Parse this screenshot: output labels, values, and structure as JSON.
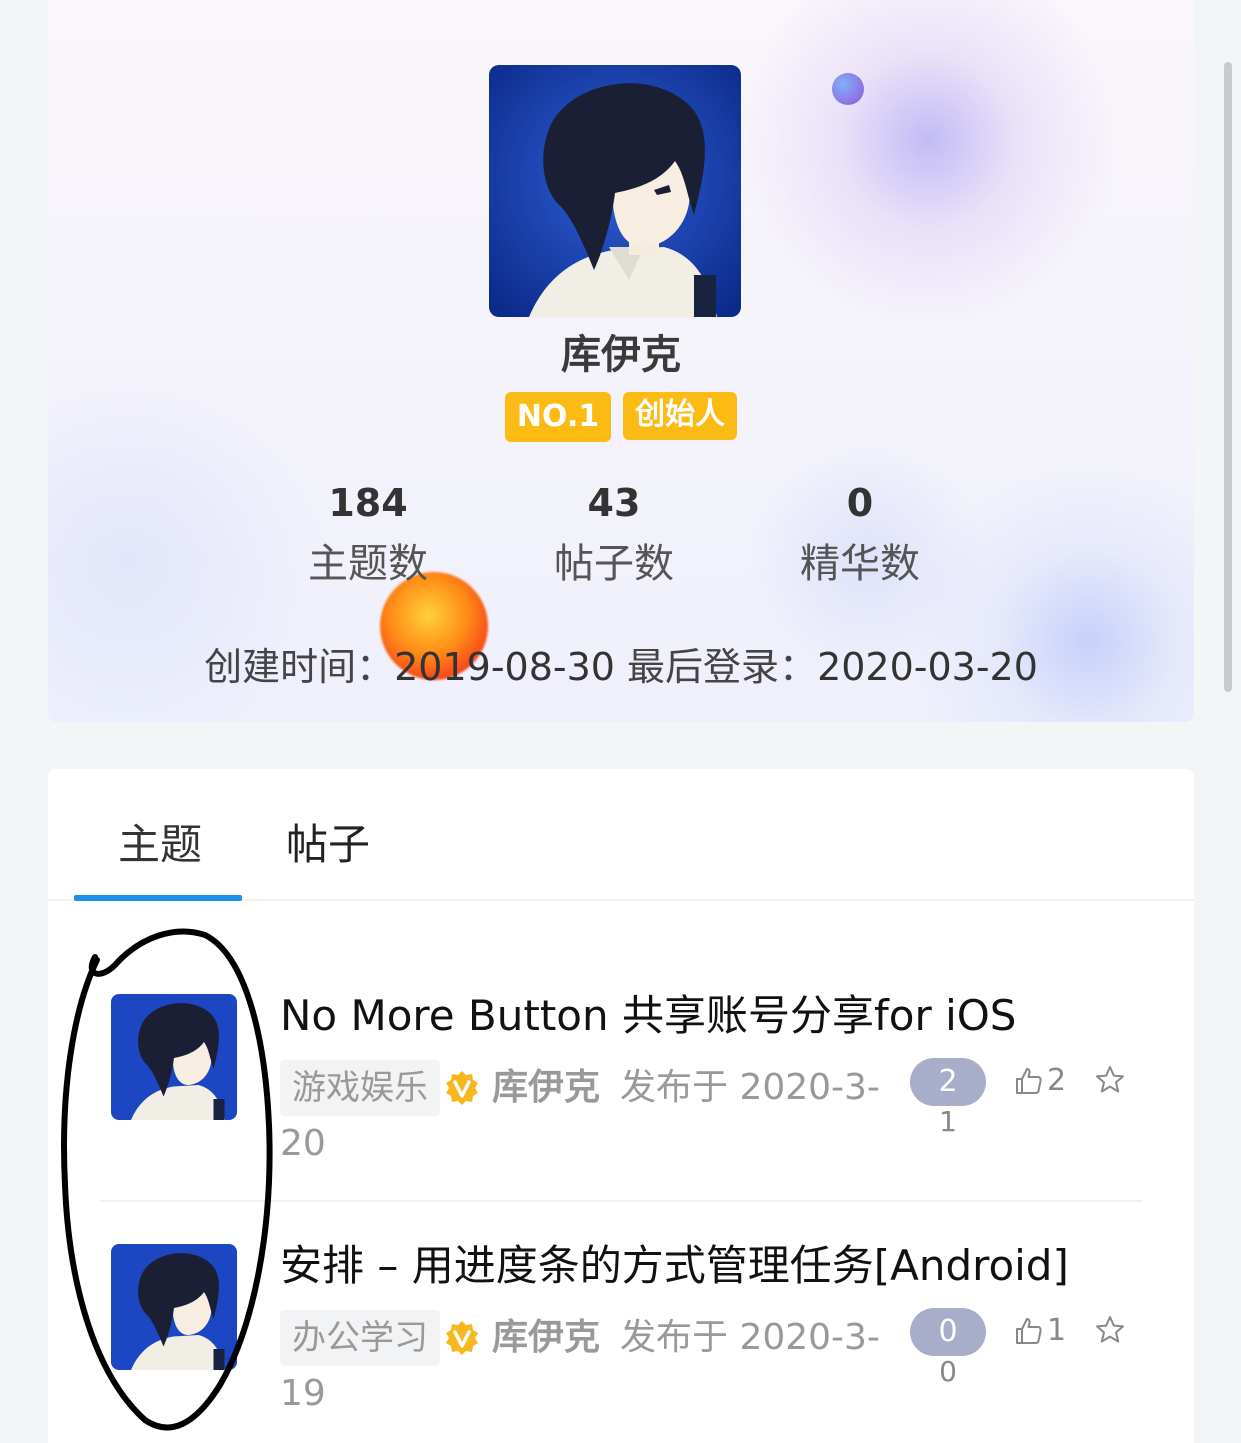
{
  "profile": {
    "name": "库伊克",
    "badges": [
      "NO.1",
      "创始人"
    ],
    "stats": [
      {
        "value": "184",
        "label": "主题数"
      },
      {
        "value": "43",
        "label": "帖子数"
      },
      {
        "value": "0",
        "label": "精华数"
      }
    ],
    "created_label": "创建时间：",
    "created_value": "2019-08-30",
    "last_login_label": "最后登录：",
    "last_login_value": "2020-03-20"
  },
  "tabs": [
    {
      "label": "主题",
      "active": true
    },
    {
      "label": "帖子",
      "active": false
    }
  ],
  "topics": [
    {
      "title": "No More Button 共享账号分享for iOS",
      "category": "游戏娱乐",
      "author": "库伊克",
      "published_prefix": "发布于 2020-3-",
      "published_suffix": "20",
      "replies": "2",
      "replies_sub": "1",
      "likes": "2"
    },
    {
      "title": "安排 – 用进度条的方式管理任务[Android]",
      "category": "办公学习",
      "author": "库伊克",
      "published_prefix": "发布于 2020-3-",
      "published_suffix": "19",
      "replies": "0",
      "replies_sub": "0",
      "likes": "1"
    }
  ],
  "colors": {
    "badge": "#fbbb14",
    "tab_indicator": "#1e8fe6",
    "reply_pill": "#a8aec9",
    "verified": "#f6b81e"
  },
  "icons": [
    "verified-v-icon",
    "thumbs-up-icon",
    "star-outline-icon"
  ]
}
